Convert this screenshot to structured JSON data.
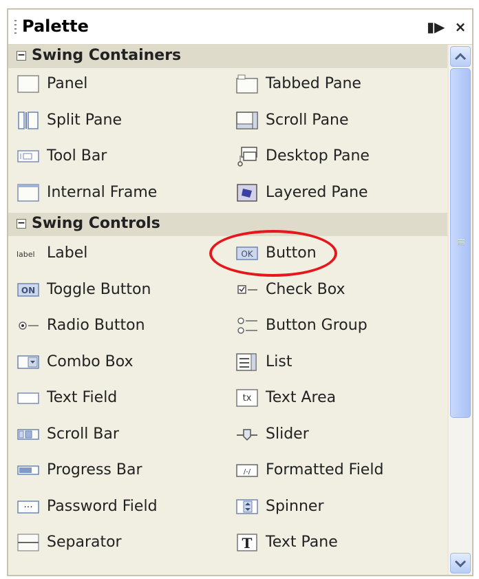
{
  "window": {
    "title": "Palette",
    "dock_label": "▮▶",
    "close_label": "×"
  },
  "categories": [
    {
      "toggle": "−",
      "label": "Swing Containers"
    },
    {
      "toggle": "−",
      "label": "Swing Controls"
    }
  ],
  "containers": [
    {
      "label": "Panel",
      "icon": "panel-icon"
    },
    {
      "label": "Tabbed Pane",
      "icon": "tabbed-pane-icon"
    },
    {
      "label": "Split Pane",
      "icon": "split-pane-icon"
    },
    {
      "label": "Scroll Pane",
      "icon": "scroll-pane-icon"
    },
    {
      "label": "Tool Bar",
      "icon": "tool-bar-icon"
    },
    {
      "label": "Desktop Pane",
      "icon": "desktop-pane-icon"
    },
    {
      "label": "Internal Frame",
      "icon": "internal-frame-icon"
    },
    {
      "label": "Layered Pane",
      "icon": "layered-pane-icon"
    }
  ],
  "controls": [
    {
      "label": "Label",
      "icon": "label-icon",
      "icon_text": "label"
    },
    {
      "label": "Button",
      "icon": "button-icon",
      "icon_text": "OK"
    },
    {
      "label": "Toggle Button",
      "icon": "toggle-button-icon",
      "icon_text": "ON"
    },
    {
      "label": "Check Box",
      "icon": "check-box-icon"
    },
    {
      "label": "Radio Button",
      "icon": "radio-button-icon"
    },
    {
      "label": "Button Group",
      "icon": "button-group-icon"
    },
    {
      "label": "Combo Box",
      "icon": "combo-box-icon"
    },
    {
      "label": "List",
      "icon": "list-icon"
    },
    {
      "label": "Text Field",
      "icon": "text-field-icon"
    },
    {
      "label": "Text Area",
      "icon": "text-area-icon",
      "icon_text": "tx"
    },
    {
      "label": "Scroll Bar",
      "icon": "scroll-bar-icon"
    },
    {
      "label": "Slider",
      "icon": "slider-icon"
    },
    {
      "label": "Progress Bar",
      "icon": "progress-bar-icon"
    },
    {
      "label": "Formatted Field",
      "icon": "formatted-field-icon"
    },
    {
      "label": "Password Field",
      "icon": "password-field-icon",
      "icon_text": "···"
    },
    {
      "label": "Spinner",
      "icon": "spinner-icon"
    },
    {
      "label": "Separator",
      "icon": "separator-icon"
    },
    {
      "label": "Text Pane",
      "icon": "text-pane-icon",
      "icon_text": "T"
    }
  ],
  "colors": {
    "panel_bg": "#ece9d8",
    "category_bg": "#dedbcb",
    "scroll_thumb": "#b8cdf8",
    "highlight_ellipse": "#e5171c"
  }
}
